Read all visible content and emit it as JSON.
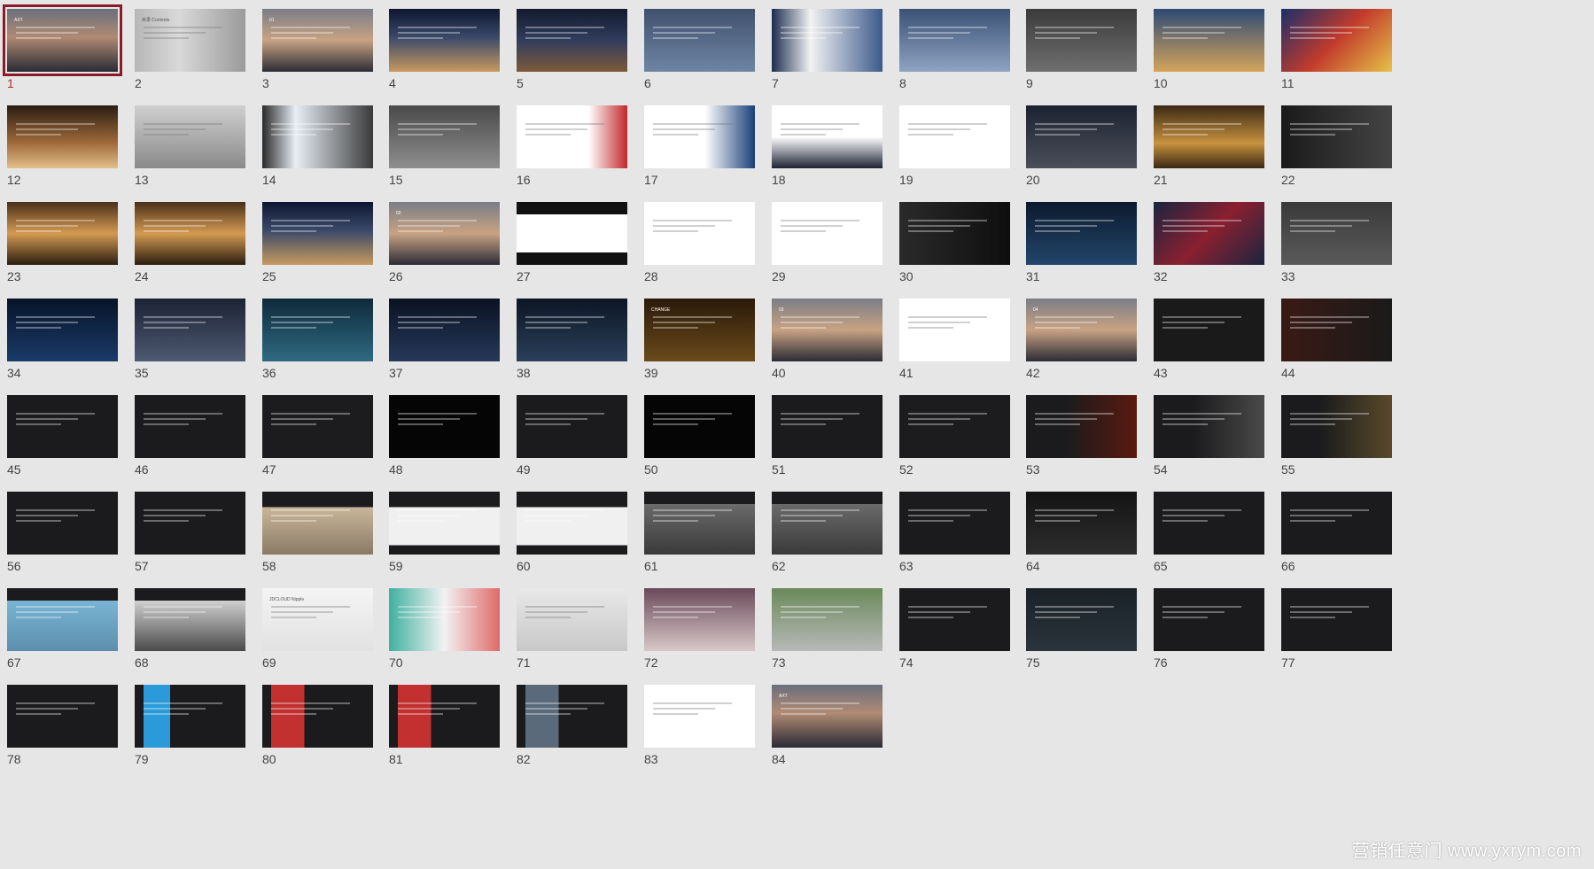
{
  "slides": [
    {
      "n": "1",
      "bg": "linear-gradient(180deg,#6a6f7c 0%,#b08a74 45%,#2a2b35 100%)",
      "title": "AXT",
      "selected": true
    },
    {
      "n": "2",
      "bg": "linear-gradient(90deg,#b7b7b7 0%,#d9d9d9 40%,#9a9a9a 100%)",
      "title": "目录 Contents",
      "light": true
    },
    {
      "n": "3",
      "bg": "linear-gradient(180deg,#7b7d86 0%,#c8a283 50%,#2b2c35 100%)",
      "title": "01"
    },
    {
      "n": "4",
      "bg": "linear-gradient(180deg,#0d1630 0%,#3a4868 45%,#c79a60 100%)",
      "title": ""
    },
    {
      "n": "5",
      "bg": "linear-gradient(180deg,#121a2e 0%,#303d5c 50%,#7d5a3a 100%)",
      "title": ""
    },
    {
      "n": "6",
      "bg": "linear-gradient(180deg,#40516d 0%,#6e85a4 100%)",
      "title": ""
    },
    {
      "n": "7",
      "bg": "linear-gradient(90deg,#1b2d4f 0%,#f2f2f2 35%,#3c5a8c 100%)",
      "title": ""
    },
    {
      "n": "8",
      "bg": "linear-gradient(180deg,#3b5276 0%,#8fa3c2 100%)",
      "title": ""
    },
    {
      "n": "9",
      "bg": "linear-gradient(180deg,#3b3b3b 0%,#6f6f6f 100%)",
      "title": ""
    },
    {
      "n": "10",
      "bg": "linear-gradient(180deg,#2e4a75 0%,#d4a45a 100%)",
      "title": ""
    },
    {
      "n": "11",
      "bg": "linear-gradient(135deg,#1a2f6a 0%,#c23b2b 50%,#e6c24a 100%)",
      "title": ""
    },
    {
      "n": "12",
      "bg": "linear-gradient(180deg,#2a1d12 0%,#a06a3a 60%,#e3c08a 100%)",
      "title": ""
    },
    {
      "n": "13",
      "bg": "linear-gradient(180deg,#cfcfcf 0%,#8a8a8a 100%)",
      "title": "",
      "light": true
    },
    {
      "n": "14",
      "bg": "linear-gradient(90deg,#2a2a2a 0%,#e8eef5 30%,#3a3a3a 100%)",
      "title": ""
    },
    {
      "n": "15",
      "bg": "linear-gradient(180deg,#4a4a4a 0%,#8e8e8e 100%)",
      "title": ""
    },
    {
      "n": "16",
      "bg": "linear-gradient(90deg,#ffffff 0%,#ffffff 65%,#c2282c 100%)",
      "title": "",
      "light": true
    },
    {
      "n": "17",
      "bg": "linear-gradient(90deg,#ffffff 0%,#ffffff 55%,#1a3f7a 100%)",
      "title": "",
      "light": true
    },
    {
      "n": "18",
      "bg": "linear-gradient(180deg,#ffffff 0%,#ffffff 50%,#1c2233 100%)",
      "title": "",
      "light": true
    },
    {
      "n": "19",
      "bg": "#ffffff",
      "title": "",
      "light": true
    },
    {
      "n": "20",
      "bg": "linear-gradient(180deg,#1c2230 0%,#4a4f5a 100%)",
      "title": ""
    },
    {
      "n": "21",
      "bg": "linear-gradient(180deg,#3a2815 0%,#c7923e 60%,#3a2815 100%)",
      "title": ""
    },
    {
      "n": "22",
      "bg": "linear-gradient(90deg,#1a1a1a 0%,#444 100%)",
      "title": ""
    },
    {
      "n": "23",
      "bg": "linear-gradient(180deg,#4a2f18 0%,#d49a52 50%,#2c1d10 100%)",
      "title": ""
    },
    {
      "n": "24",
      "bg": "linear-gradient(180deg,#4a2f18 0%,#d49a52 50%,#2c1d10 100%)",
      "title": ""
    },
    {
      "n": "25",
      "bg": "linear-gradient(180deg,#0d1630 0%,#3a4868 45%,#c79a60 100%)",
      "title": ""
    },
    {
      "n": "26",
      "bg": "linear-gradient(180deg,#7b7d86 0%,#c8a283 50%,#2b2c35 100%)",
      "title": "02"
    },
    {
      "n": "27",
      "bg": "linear-gradient(180deg,#111 0%,#111 20%,#ffffff 20%,#ffffff 80%,#111 80%)",
      "title": ""
    },
    {
      "n": "28",
      "bg": "#ffffff",
      "title": "",
      "light": true
    },
    {
      "n": "29",
      "bg": "#ffffff",
      "title": "",
      "light": true
    },
    {
      "n": "30",
      "bg": "linear-gradient(90deg,#2a2a2a 0%,#0e0e0e 100%)",
      "title": ""
    },
    {
      "n": "31",
      "bg": "linear-gradient(180deg,#0c1a2e 0%,#22466a 100%)",
      "title": ""
    },
    {
      "n": "32",
      "bg": "linear-gradient(135deg,#1a2540 0%,#8a2030 50%,#1a2540 100%)",
      "title": ""
    },
    {
      "n": "33",
      "bg": "linear-gradient(180deg,#3a3a3a 0%,#5a5a5a 100%)",
      "title": ""
    },
    {
      "n": "34",
      "bg": "linear-gradient(180deg,#071428 0%,#1a3a6a 100%)",
      "title": ""
    },
    {
      "n": "35",
      "bg": "linear-gradient(180deg,#1b2234 0%,#4e5a72 100%)",
      "title": ""
    },
    {
      "n": "36",
      "bg": "linear-gradient(180deg,#0e2a3a 0%,#2f6a82 100%)",
      "title": ""
    },
    {
      "n": "37",
      "bg": "linear-gradient(180deg,#0a1222 0%,#26395a 100%)",
      "title": ""
    },
    {
      "n": "38",
      "bg": "linear-gradient(180deg,#0c1624 0%,#2a3f5a 100%)",
      "title": ""
    },
    {
      "n": "39",
      "bg": "linear-gradient(180deg,#2a1a0a 0%,#6a4a1a 100%)",
      "title": "CHANGE"
    },
    {
      "n": "40",
      "bg": "linear-gradient(180deg,#7b7d86 0%,#c8a283 50%,#2b2c35 100%)",
      "title": "03"
    },
    {
      "n": "41",
      "bg": "#ffffff",
      "title": "",
      "light": true
    },
    {
      "n": "42",
      "bg": "linear-gradient(180deg,#7b7d86 0%,#c8a283 50%,#2b2c35 100%)",
      "title": "04"
    },
    {
      "n": "43",
      "bg": "#1a1a1a",
      "title": ""
    },
    {
      "n": "44",
      "bg": "linear-gradient(90deg,#3a1a14 0%,#1a1a1a 100%)",
      "title": ""
    },
    {
      "n": "45",
      "bg": "#1b1b1d",
      "title": ""
    },
    {
      "n": "46",
      "bg": "#1b1b1d",
      "title": ""
    },
    {
      "n": "47",
      "bg": "#1c1c1e",
      "title": ""
    },
    {
      "n": "48",
      "bg": "#050505",
      "title": ""
    },
    {
      "n": "49",
      "bg": "#1b1b1d",
      "title": ""
    },
    {
      "n": "50",
      "bg": "#050505",
      "title": ""
    },
    {
      "n": "51",
      "bg": "#1b1b1d",
      "title": ""
    },
    {
      "n": "52",
      "bg": "#1c1c1e",
      "title": ""
    },
    {
      "n": "53",
      "bg": "linear-gradient(90deg,#1b1b1d 0%,#1b1b1d 35%,#5a1a10 100%)",
      "title": ""
    },
    {
      "n": "54",
      "bg": "linear-gradient(90deg,#1b1b1d 0%,#1b1b1d 35%,#4a4a4a 100%)",
      "title": ""
    },
    {
      "n": "55",
      "bg": "linear-gradient(90deg,#1b1b1d 0%,#1b1b1d 35%,#5a4a2a 100%)",
      "title": ""
    },
    {
      "n": "56",
      "bg": "#1b1b1d",
      "title": ""
    },
    {
      "n": "57",
      "bg": "#1b1b1d",
      "title": ""
    },
    {
      "n": "58",
      "bg": "linear-gradient(180deg,#1b1b1d 0%,#1b1b1d 25%,#c9b69a 25%,#8a7a66 100%)",
      "title": ""
    },
    {
      "n": "59",
      "bg": "linear-gradient(180deg,#1b1b1d 0%,#1b1b1d 25%,#f0f0f0 25%,#f0f0f0 85%,#1b1b1d 85%)",
      "title": ""
    },
    {
      "n": "60",
      "bg": "linear-gradient(180deg,#1b1b1d 0%,#1b1b1d 25%,#f0f0f0 25%,#f0f0f0 85%,#1b1b1d 85%)",
      "title": ""
    },
    {
      "n": "61",
      "bg": "linear-gradient(180deg,#1b1b1d 0%,#1b1b1d 20%,#6a6a6a 20%,#3a3a3a 100%)",
      "title": ""
    },
    {
      "n": "62",
      "bg": "linear-gradient(180deg,#1b1b1d 0%,#1b1b1d 20%,#6a6a6a 20%,#3a3a3a 100%)",
      "title": ""
    },
    {
      "n": "63",
      "bg": "#1b1b1d",
      "title": ""
    },
    {
      "n": "64",
      "bg": "linear-gradient(180deg,#141414 0%,#2c2c2c 100%)",
      "title": ""
    },
    {
      "n": "65",
      "bg": "#1b1b1d",
      "title": ""
    },
    {
      "n": "66",
      "bg": "#1b1b1d",
      "title": ""
    },
    {
      "n": "67",
      "bg": "linear-gradient(180deg,#1b1b1d 0%,#1b1b1d 20%,#7ab4d4 20%,#5c8fad 100%)",
      "title": ""
    },
    {
      "n": "68",
      "bg": "linear-gradient(180deg,#1b1b1d 0%,#1b1b1d 20%,#cfcfcf 20%,#4a4a4a 100%)",
      "title": ""
    },
    {
      "n": "69",
      "bg": "linear-gradient(180deg,#f4f4f4 0%,#e2e2e2 100%)",
      "title": "JDCLOUD Nipple",
      "light": true
    },
    {
      "n": "70",
      "bg": "linear-gradient(90deg,#3fb0a0 0%,#f2f2f2 50%,#e06a6a 100%)",
      "title": ""
    },
    {
      "n": "71",
      "bg": "linear-gradient(180deg,#e8e8e8 0%,#c8c8c8 100%)",
      "title": "",
      "light": true
    },
    {
      "n": "72",
      "bg": "linear-gradient(180deg,#6a4a5a 0%,#d8c8c8 100%)",
      "title": ""
    },
    {
      "n": "73",
      "bg": "linear-gradient(180deg,#6a8a5a 0%,#b8b8b8 100%)",
      "title": ""
    },
    {
      "n": "74",
      "bg": "#1b1b1d",
      "title": ""
    },
    {
      "n": "75",
      "bg": "linear-gradient(180deg,#1a2228 0%,#2a343c 100%)",
      "title": ""
    },
    {
      "n": "76",
      "bg": "#1b1b1d",
      "title": ""
    },
    {
      "n": "77",
      "bg": "#1b1b1d",
      "title": ""
    },
    {
      "n": "78",
      "bg": "#1b1b1d",
      "title": ""
    },
    {
      "n": "79",
      "bg": "linear-gradient(90deg,#1b1b1d 0%,#1b1b1d 8%,#2a9ad8 8%,#2a9ad8 32%,#1b1b1d 32%)",
      "title": ""
    },
    {
      "n": "80",
      "bg": "linear-gradient(90deg,#1b1b1d 0%,#1b1b1d 8%,#c23030 8%,#c23030 38%,#1b1b1d 38%)",
      "title": ""
    },
    {
      "n": "81",
      "bg": "linear-gradient(90deg,#1b1b1d 0%,#1b1b1d 8%,#c23030 8%,#c23030 38%,#1b1b1d 38%)",
      "title": ""
    },
    {
      "n": "82",
      "bg": "linear-gradient(90deg,#1b1b1d 0%,#1b1b1d 8%,#5a6a7a 8%,#5a6a7a 38%,#1b1b1d 38%)",
      "title": ""
    },
    {
      "n": "83",
      "bg": "#ffffff",
      "title": "",
      "light": true
    },
    {
      "n": "84",
      "bg": "linear-gradient(180deg,#6a6f7c 0%,#b08a74 45%,#2a2b35 100%)",
      "title": "AXT"
    }
  ],
  "watermark": "营销任意门 www.yxrym.com"
}
